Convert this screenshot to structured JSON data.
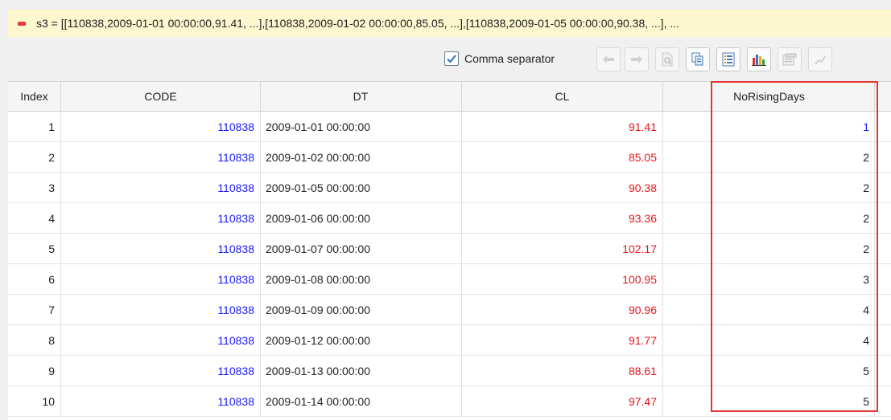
{
  "variable_bar": {
    "expression": "s3 = [[110838,2009-01-01 00:00:00,91.41, ...],[110838,2009-01-02 00:00:00,85.05, ...],[110838,2009-01-05 00:00:00,90.38, ...], ..."
  },
  "toolbar": {
    "comma_separator_label": "Comma separator",
    "comma_separator_checked": true,
    "buttons": [
      "back-arrow-icon",
      "forward-arrow-icon",
      "inspect-icon",
      "copy-icon",
      "list-icon",
      "chart-icon",
      "export-icon",
      "plot-icon"
    ]
  },
  "table": {
    "columns": [
      "Index",
      "CODE",
      "DT",
      "CL",
      "NoRisingDays"
    ],
    "rows": [
      {
        "index": "1",
        "code": "110838",
        "dt": "2009-01-01 00:00:00",
        "cl": "91.41",
        "nrd": "1"
      },
      {
        "index": "2",
        "code": "110838",
        "dt": "2009-01-02 00:00:00",
        "cl": "85.05",
        "nrd": "2"
      },
      {
        "index": "3",
        "code": "110838",
        "dt": "2009-01-05 00:00:00",
        "cl": "90.38",
        "nrd": "2"
      },
      {
        "index": "4",
        "code": "110838",
        "dt": "2009-01-06 00:00:00",
        "cl": "93.36",
        "nrd": "2"
      },
      {
        "index": "5",
        "code": "110838",
        "dt": "2009-01-07 00:00:00",
        "cl": "102.17",
        "nrd": "2"
      },
      {
        "index": "6",
        "code": "110838",
        "dt": "2009-01-08 00:00:00",
        "cl": "100.95",
        "nrd": "3"
      },
      {
        "index": "7",
        "code": "110838",
        "dt": "2009-01-09 00:00:00",
        "cl": "90.96",
        "nrd": "4"
      },
      {
        "index": "8",
        "code": "110838",
        "dt": "2009-01-12 00:00:00",
        "cl": "91.77",
        "nrd": "4"
      },
      {
        "index": "9",
        "code": "110838",
        "dt": "2009-01-13 00:00:00",
        "cl": "88.61",
        "nrd": "5"
      },
      {
        "index": "10",
        "code": "110838",
        "dt": "2009-01-14 00:00:00",
        "cl": "97.47",
        "nrd": "5"
      }
    ]
  },
  "colors": {
    "accent_blue": "#1a1aff",
    "value_red": "#e8131a",
    "highlight_border": "#e53434",
    "variable_bar_bg": "#fdf7cf"
  }
}
